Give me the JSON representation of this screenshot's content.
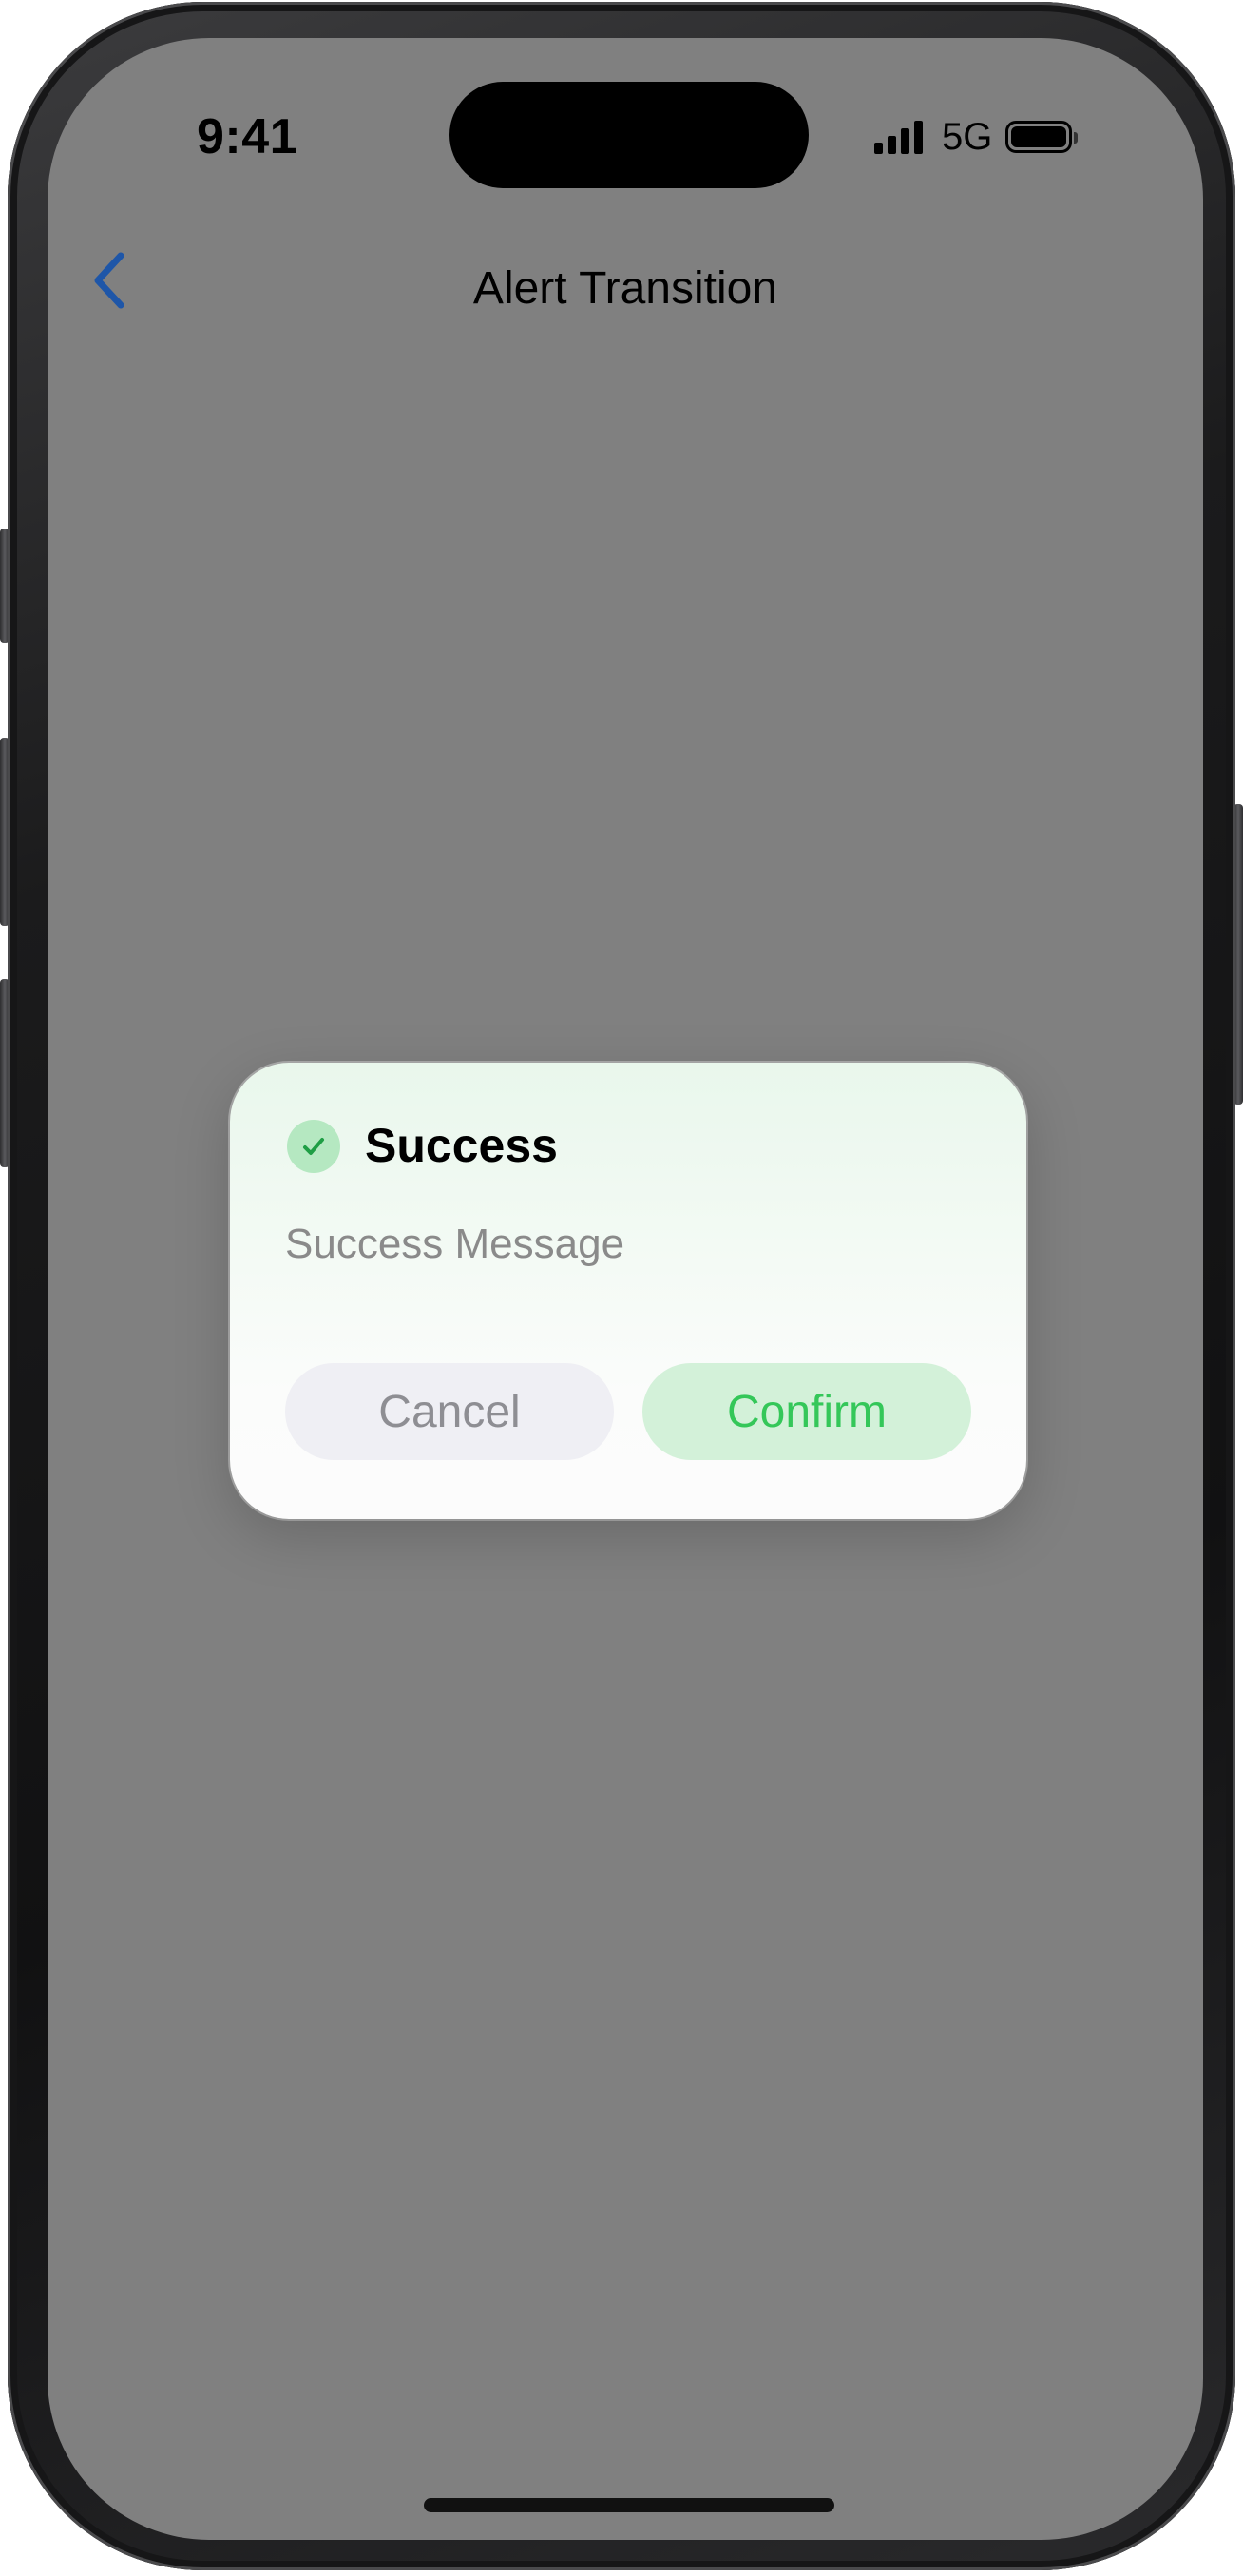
{
  "status_bar": {
    "time": "9:41",
    "network": "5G",
    "signal_icon": "signal-bars-icon",
    "battery_icon": "battery-icon"
  },
  "nav": {
    "title": "Alert Transition",
    "back_icon": "chevron-left-icon"
  },
  "alert": {
    "icon": "checkmark-circle-icon",
    "title": "Success",
    "message": "Success Message",
    "cancel_label": "Cancel",
    "confirm_label": "Confirm"
  },
  "colors": {
    "accent_blue": "#1e56a8",
    "success_green": "#34c759",
    "overlay_gray": "#808080"
  }
}
